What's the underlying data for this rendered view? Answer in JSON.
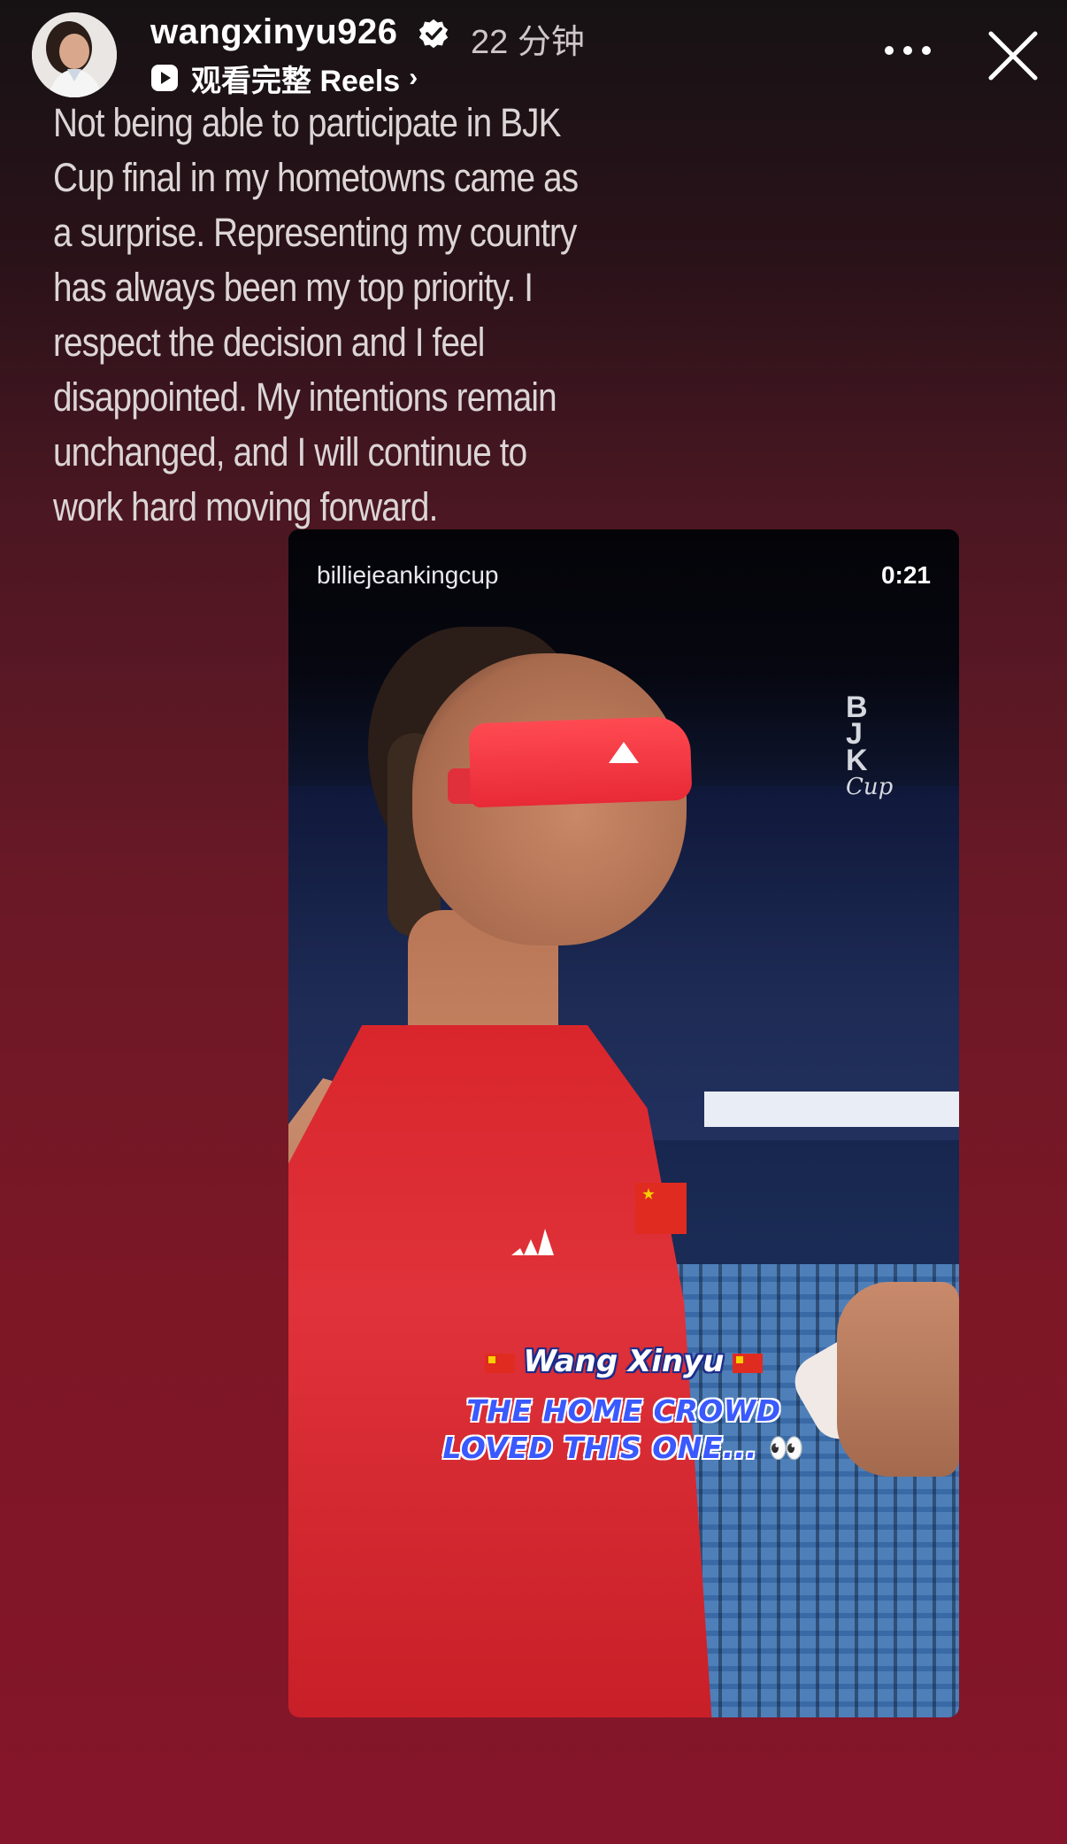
{
  "header": {
    "username": "wangxinyu926",
    "time_ago": "22 分钟",
    "reels_link": "观看完整 Reels",
    "reels_chevron": "›"
  },
  "story": {
    "text": "Not  being able to participate in BJK Cup final in my hometowns came as a surprise. Representing my country has always been my top priority.  I respect the decision and I feel disappointed.  My intentions remain unchanged, and I will continue to work hard moving forward."
  },
  "video": {
    "account": "billiejeankingcup",
    "duration": "0:21",
    "logo_letters": [
      "B",
      "J",
      "K"
    ],
    "logo_cup": "Cup",
    "caption_name": "Wang Xinyu",
    "caption_line1": "THE HOME CROWD",
    "caption_line2": "LOVED THIS ONE...",
    "caption_emoji": "👀"
  },
  "colors": {
    "verified": "#3897f0",
    "caption_blue": "#3a59ff"
  },
  "icons": [
    "verified-icon",
    "reels-icon",
    "more-icon",
    "close-icon"
  ]
}
